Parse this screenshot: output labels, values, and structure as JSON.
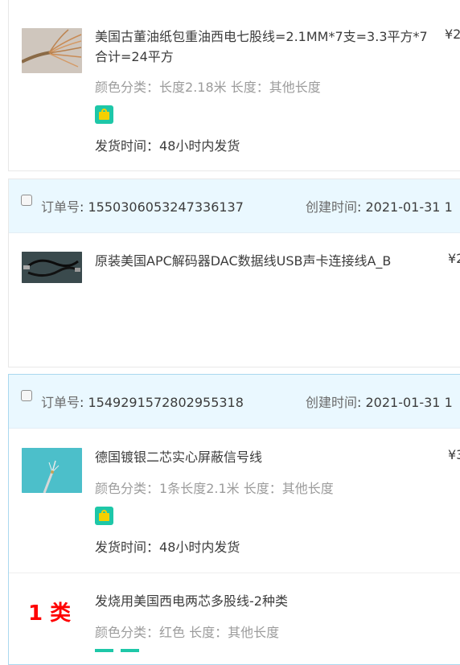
{
  "orders": [
    {
      "items": [
        {
          "title": "美国古董油纸包重油西电七股线=2.1MM*7支=3.3平方*7合计=24平方",
          "price": "¥2",
          "attr_label": "颜色分类：",
          "attr_value": "长度2.18米  长度：其他长度",
          "ship_label": "发货时间：",
          "ship_value": "48小时内发货",
          "badge_icon": "tmall-bag-icon"
        }
      ]
    },
    {
      "order_label": "订单号",
      "order_no": "1550306053247336137",
      "created_label": "创建时间",
      "created_value": "2021-01-31 1",
      "items": [
        {
          "title": "原装美国APC解码器DAC数据线USB声卡连接线A_B",
          "price": "¥2"
        }
      ]
    },
    {
      "order_label": "订单号",
      "order_no": "1549291572802955318",
      "created_label": "创建时间",
      "created_value": "2021-01-31 1",
      "items": [
        {
          "title": "德国镀银二芯实心屏蔽信号线",
          "price": "¥3",
          "attr_label": "颜色分类：",
          "attr_value": "1条长度2.1米  长度：其他长度",
          "ship_label": "发货时间：",
          "ship_value": "48小时内发货",
          "badge_icon": "tmall-bag-icon"
        },
        {
          "marker": "1 类",
          "title": "发烧用美国西电两芯多股线-2种类",
          "price": "¥",
          "attr_label": "颜色分类：",
          "attr_value": "红色  长度：其他长度"
        }
      ]
    }
  ],
  "colors": {
    "header_bg": "#eaf8ff",
    "marker_red": "#ff0000",
    "badge_green": "#1ec7a8",
    "badge_yellow": "#f5d000"
  }
}
